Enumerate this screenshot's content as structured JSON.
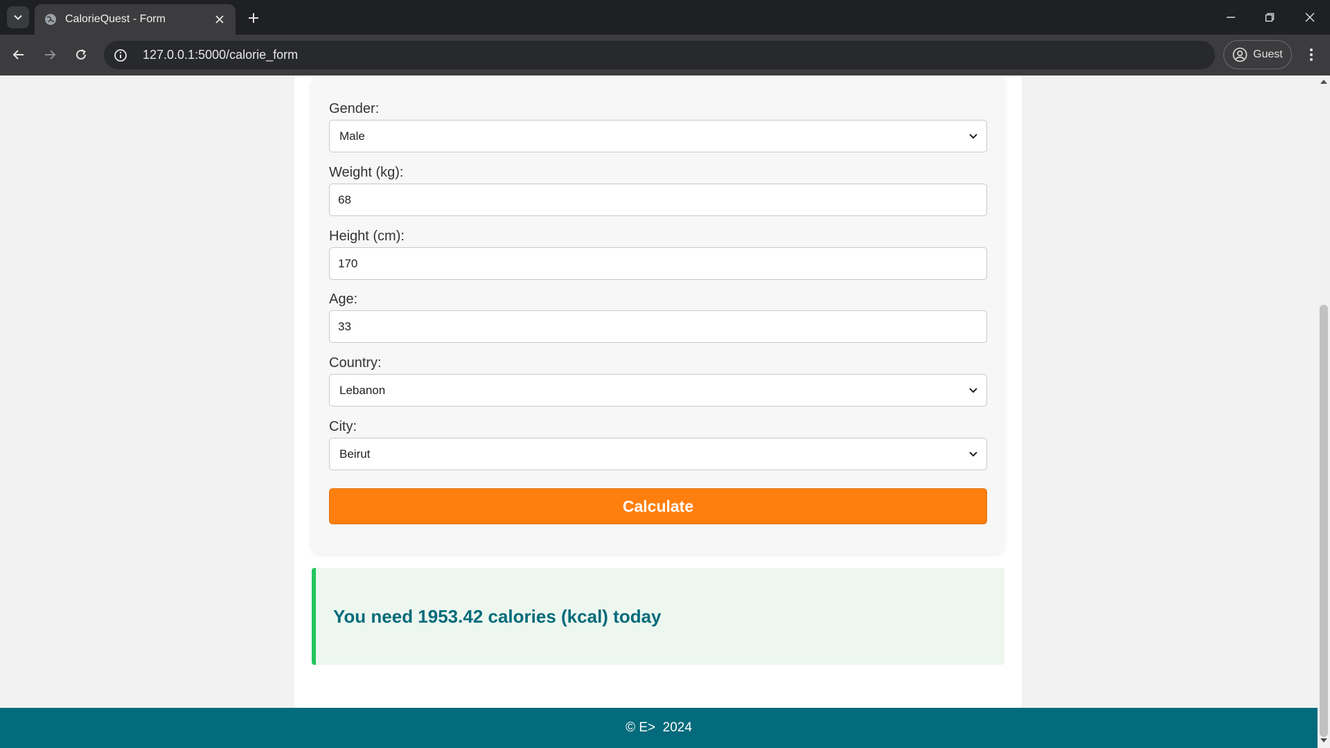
{
  "browser": {
    "tab_title": "CalorieQuest - Form",
    "url": "127.0.0.1:5000/calorie_form",
    "profile_label": "Guest"
  },
  "form": {
    "gender": {
      "label": "Gender:",
      "value": "Male"
    },
    "weight": {
      "label": "Weight (kg):",
      "value": "68"
    },
    "height": {
      "label": "Height (cm):",
      "value": "170"
    },
    "age": {
      "label": "Age:",
      "value": "33"
    },
    "country": {
      "label": "Country:",
      "value": "Lebanon"
    },
    "city": {
      "label": "City:",
      "value": "Beirut"
    },
    "submit_label": "Calculate"
  },
  "result": {
    "message": "You need 1953.42 calories (kcal) today"
  },
  "footer": {
    "text": "© E>  2024"
  },
  "colors": {
    "accent_button": "#ff7f0e",
    "result_border": "#22c55e",
    "result_text": "#036b7b",
    "footer_bg": "#036b7b"
  },
  "icons": [
    "tab-search-icon",
    "globe-icon",
    "close-icon",
    "plus-icon",
    "minimize-icon",
    "restore-icon",
    "window-close-icon",
    "back-arrow-icon",
    "forward-arrow-icon",
    "reload-icon",
    "site-info-icon",
    "profile-icon",
    "kebab-menu-icon",
    "chevron-down-icon"
  ]
}
